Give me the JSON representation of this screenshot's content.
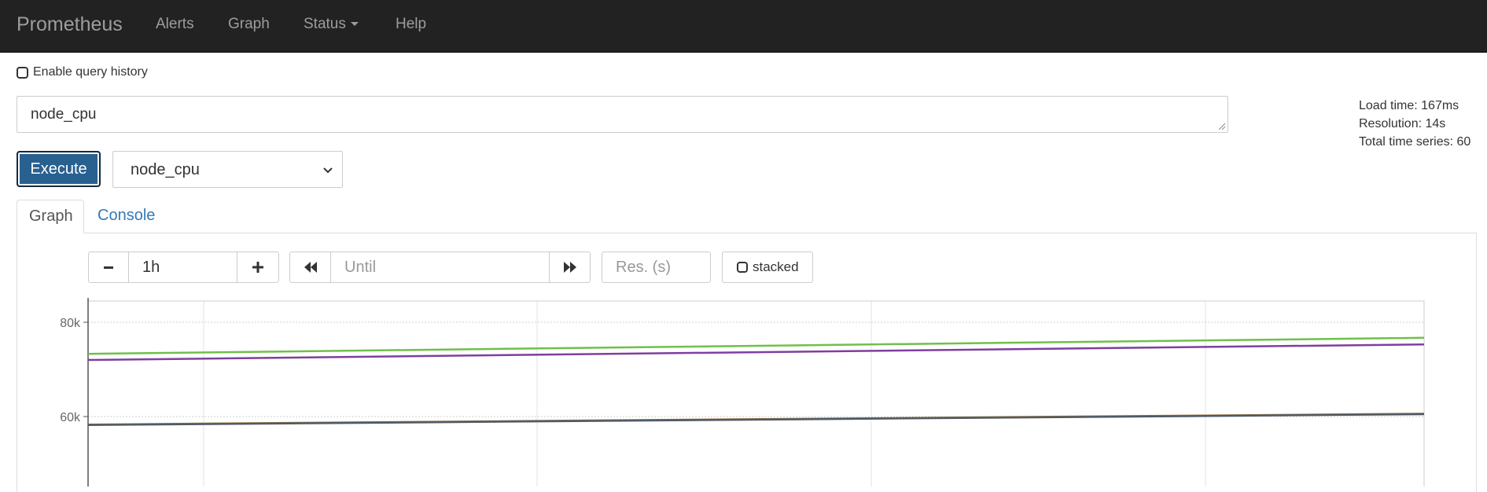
{
  "navbar": {
    "brand": "Prometheus",
    "links": [
      "Alerts",
      "Graph",
      "Status",
      "Help"
    ]
  },
  "query_history": {
    "label": "Enable query history",
    "checked": false
  },
  "query": {
    "value": "node_cpu"
  },
  "stats": {
    "load_time": "Load time: 167ms",
    "resolution": "Resolution: 14s",
    "total_series": "Total time series: 60"
  },
  "execute_label": "Execute",
  "metric_select": {
    "selected": "node_cpu"
  },
  "tabs": [
    {
      "label": "Graph",
      "active": true
    },
    {
      "label": "Console",
      "active": false
    }
  ],
  "graph_controls": {
    "range_decrease": "−",
    "range_value": "1h",
    "range_increase": "+",
    "back_icon": "double-left-arrow-icon",
    "until_placeholder": "Until",
    "forward_icon": "double-right-arrow-icon",
    "resolution_placeholder": "Res. (s)",
    "stacked_label": "stacked",
    "stacked_checked": false
  },
  "chart_data": {
    "type": "line",
    "y_ticks": [
      "80k",
      "60k"
    ],
    "grid": true,
    "series": [
      {
        "color": "#6fc04b",
        "values": [
          73300,
          76700
        ]
      },
      {
        "color": "#7e3f9e",
        "values": [
          72000,
          75300
        ]
      },
      {
        "color": "#a0763e",
        "values": [
          58300,
          60600
        ]
      },
      {
        "color": "#4f5b66",
        "values": [
          58200,
          60500
        ]
      }
    ]
  }
}
